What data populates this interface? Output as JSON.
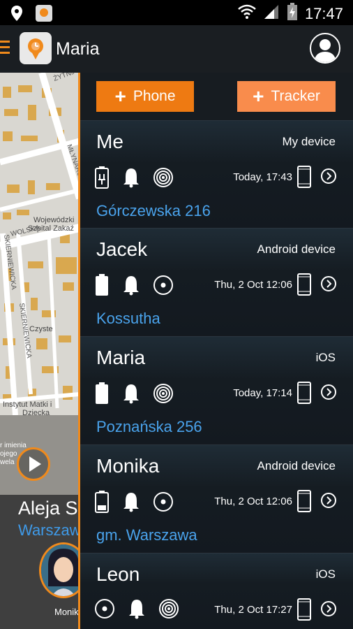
{
  "statusbar": {
    "time": "17:47"
  },
  "appbar": {
    "title": "Maria"
  },
  "map": {
    "streets": [
      "ŻYTNIA",
      "MŁYNARSKA",
      "WOLSKA",
      "SKIERNIEWICKA",
      "SKIERNIEWICKA"
    ],
    "places": [
      "Wojewódzki Szpital Zakaź",
      "Czyste",
      "Instytut Matki i Dziecka",
      "r imienia ojego wela"
    ],
    "address": "Aleja S",
    "city": "Warszaw",
    "avatar_label": "Monik"
  },
  "buttons": {
    "phone": "Phone",
    "tracker": "Tracker"
  },
  "devices": [
    {
      "name": "Me",
      "type": "My device",
      "time": "Today, 17:43",
      "address": "Górczewska 216"
    },
    {
      "name": "Jacek",
      "type": "Android device",
      "time": "Thu, 2 Oct 12:06",
      "address": "Kossutha"
    },
    {
      "name": "Maria",
      "type": "iOS",
      "time": "Today, 17:14",
      "address": "Poznańska 256"
    },
    {
      "name": "Monika",
      "type": "Android device",
      "time": "Thu, 2 Oct 12:06",
      "address": "gm. Warszawa"
    },
    {
      "name": "Leon",
      "type": "iOS",
      "time": "Thu, 2 Oct 17:27",
      "address": ""
    }
  ],
  "colors": {
    "accent": "#ee7a12",
    "link": "#4aa3ec"
  }
}
